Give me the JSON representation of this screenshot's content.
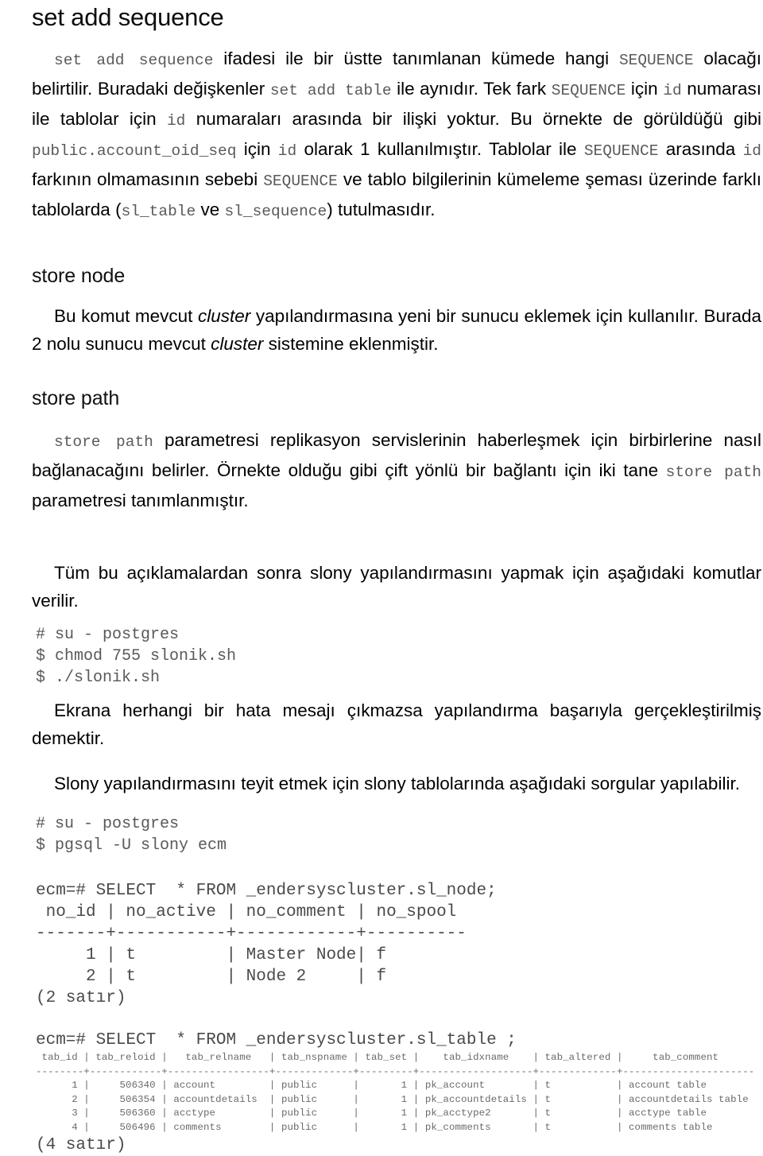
{
  "document": {
    "title": "set add sequence",
    "sections": [
      {
        "id": "set-add-sequence",
        "heading": "set add sequence",
        "paragraph_runs": [
          {
            "t": "code",
            "v": "set add sequence"
          },
          {
            "t": "text",
            "v": " ifadesi ile bir üstte tanımlanan kümede hangi "
          },
          {
            "t": "code",
            "v": "SEQUENCE"
          },
          {
            "t": "text",
            "v": " olacağı belirtilir. Buradaki değişkenler "
          },
          {
            "t": "code",
            "v": "set add table"
          },
          {
            "t": "text",
            "v": " ile aynıdır. Tek fark "
          },
          {
            "t": "code",
            "v": "SEQUENCE"
          },
          {
            "t": "text",
            "v": " için "
          },
          {
            "t": "code",
            "v": "id"
          },
          {
            "t": "text",
            "v": " numarası ile tablolar için "
          },
          {
            "t": "code",
            "v": "id"
          },
          {
            "t": "text",
            "v": " numaraları arasında bir ilişki yoktur. Bu örnekte de görüldüğü gibi "
          },
          {
            "t": "code",
            "v": "public.account_oid_seq"
          },
          {
            "t": "text",
            "v": " için "
          },
          {
            "t": "code",
            "v": "id"
          },
          {
            "t": "text",
            "v": " olarak 1 kullanılmıştır. Tablolar ile "
          },
          {
            "t": "code",
            "v": "SEQUENCE"
          },
          {
            "t": "text",
            "v": " arasında "
          },
          {
            "t": "code",
            "v": "id"
          },
          {
            "t": "text",
            "v": " farkının olmamasının sebebi "
          },
          {
            "t": "code",
            "v": "SEQUENCE"
          },
          {
            "t": "text",
            "v": " ve tablo bilgilerinin kümeleme şeması üzerinde farklı tablolarda ("
          },
          {
            "t": "code",
            "v": "sl_table"
          },
          {
            "t": "text",
            "v": " ve "
          },
          {
            "t": "code",
            "v": "sl_sequence"
          },
          {
            "t": "text",
            "v": ") tutulmasıdır."
          }
        ]
      },
      {
        "id": "store-node",
        "heading": "store node",
        "paragraph_runs": [
          {
            "t": "text",
            "v": "Bu komut mevcut "
          },
          {
            "t": "italic",
            "v": "cluster"
          },
          {
            "t": "text",
            "v": " yapılandırmasına yeni bir sunucu eklemek için kullanılır. Burada 2 nolu sunucu mevcut "
          },
          {
            "t": "italic",
            "v": "cluster"
          },
          {
            "t": "text",
            "v": " sistemine eklenmiştir."
          }
        ]
      },
      {
        "id": "store-path",
        "heading": "store path",
        "paragraph_runs": [
          {
            "t": "code",
            "v": "store path"
          },
          {
            "t": "text",
            "v": " parametresi replikasyon servislerinin haberleşmek için birbirlerine nasıl bağlanacağını belirler.  Örnekte olduğu gibi çift yönlü bir bağlantı için iki tane "
          },
          {
            "t": "code",
            "v": "store path"
          },
          {
            "t": "text",
            "v": " parametresi tanımlanmıştır."
          }
        ]
      }
    ],
    "closing": {
      "para_commands_intro": "Tüm bu açıklamalardan sonra slony yapılandırmasını yapmak için aşağıdaki komutlar verilir.",
      "code_block_setup": "# su - postgres\n$ chmod 755 slonik.sh\n$ ./slonik.sh",
      "para_success": "Ekrana herhangi bir hata mesajı çıkmazsa yapılandırma başarıyla gerçekleştirilmiş demektir.",
      "para_verify": "Slony yapılandırmasını teyit etmek için slony tablolarında aşağıdaki sorgular yapılabilir.",
      "code_block_psql": "# su - postgres\n$ pgsql -U slony ecm"
    },
    "terminal": {
      "sl_node": {
        "query": "ecm=# SELECT  * FROM _endersyscluster.sl_node;",
        "header": " no_id | no_active | no_comment | no_spool",
        "separator": "-------+-----------+------------+----------",
        "rows": [
          "     1 | t         | Master Node| f",
          "     2 | t         | Node 2     | f"
        ],
        "rowcount": "(2 satır)"
      },
      "sl_table": {
        "query": "ecm=# SELECT  * FROM _endersyscluster.sl_table ;",
        "header": " tab_id | tab_reloid |   tab_relname   | tab_nspname | tab_set |    tab_idxname    | tab_altered |     tab_comment",
        "separator": "--------+------------+-----------------+-------------+---------+-------------------+-------------+----------------------",
        "rows": [
          "      1 |     506340 | account         | public      |       1 | pk_account        | t           | account table",
          "      2 |     506354 | accountdetails  | public      |       1 | pk_accountdetails | t           | accountdetails table",
          "      3 |     506360 | acctype         | public      |       1 | pk_acctype2       | t           | acctype table",
          "      4 |     506496 | comments        | public      |       1 | pk_comments       | t           | comments table"
        ],
        "rowcount": "(4 satır)",
        "columns": [
          "tab_id",
          "tab_reloid",
          "tab_relname",
          "tab_nspname",
          "tab_set",
          "tab_idxname",
          "tab_altered",
          "tab_comment"
        ],
        "data": [
          {
            "tab_id": "1",
            "tab_reloid": "506340",
            "tab_relname": "account",
            "tab_nspname": "public",
            "tab_set": "1",
            "tab_idxname": "pk_account",
            "tab_altered": "t",
            "tab_comment": "account table"
          },
          {
            "tab_id": "2",
            "tab_reloid": "506354",
            "tab_relname": "accountdetails",
            "tab_nspname": "public",
            "tab_set": "1",
            "tab_idxname": "pk_accountdetails",
            "tab_altered": "t",
            "tab_comment": "accountdetails table"
          },
          {
            "tab_id": "3",
            "tab_reloid": "506360",
            "tab_relname": "acctype",
            "tab_nspname": "public",
            "tab_set": "1",
            "tab_idxname": "pk_acctype2",
            "tab_altered": "t",
            "tab_comment": "acctype table"
          },
          {
            "tab_id": "4",
            "tab_reloid": "506496",
            "tab_relname": "comments",
            "tab_nspname": "public",
            "tab_set": "1",
            "tab_idxname": "pk_comments",
            "tab_altered": "t",
            "tab_comment": "comments table"
          }
        ]
      },
      "sl_node_data": {
        "columns": [
          "no_id",
          "no_active",
          "no_comment",
          "no_spool"
        ],
        "data": [
          {
            "no_id": "1",
            "no_active": "t",
            "no_comment": "Master Node",
            "no_spool": "f"
          },
          {
            "no_id": "2",
            "no_active": "t",
            "no_comment": "Node 2",
            "no_spool": "f"
          }
        ]
      }
    },
    "colors": {
      "body_text": "#000000",
      "code_text": "#5a5a5a",
      "terminal_text": "#4a4a4a",
      "background": "#ffffff"
    }
  }
}
